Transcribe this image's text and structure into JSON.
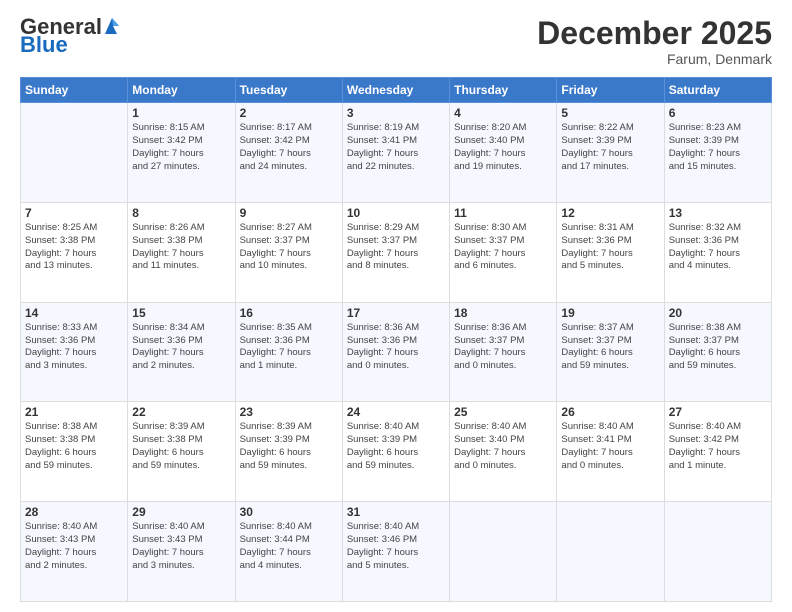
{
  "header": {
    "logo_general": "General",
    "logo_blue": "Blue",
    "month_title": "December 2025",
    "subtitle": "Farum, Denmark"
  },
  "days_of_week": [
    "Sunday",
    "Monday",
    "Tuesday",
    "Wednesday",
    "Thursday",
    "Friday",
    "Saturday"
  ],
  "weeks": [
    [
      {
        "day": "",
        "text": ""
      },
      {
        "day": "1",
        "text": "Sunrise: 8:15 AM\nSunset: 3:42 PM\nDaylight: 7 hours\nand 27 minutes."
      },
      {
        "day": "2",
        "text": "Sunrise: 8:17 AM\nSunset: 3:42 PM\nDaylight: 7 hours\nand 24 minutes."
      },
      {
        "day": "3",
        "text": "Sunrise: 8:19 AM\nSunset: 3:41 PM\nDaylight: 7 hours\nand 22 minutes."
      },
      {
        "day": "4",
        "text": "Sunrise: 8:20 AM\nSunset: 3:40 PM\nDaylight: 7 hours\nand 19 minutes."
      },
      {
        "day": "5",
        "text": "Sunrise: 8:22 AM\nSunset: 3:39 PM\nDaylight: 7 hours\nand 17 minutes."
      },
      {
        "day": "6",
        "text": "Sunrise: 8:23 AM\nSunset: 3:39 PM\nDaylight: 7 hours\nand 15 minutes."
      }
    ],
    [
      {
        "day": "7",
        "text": "Sunrise: 8:25 AM\nSunset: 3:38 PM\nDaylight: 7 hours\nand 13 minutes."
      },
      {
        "day": "8",
        "text": "Sunrise: 8:26 AM\nSunset: 3:38 PM\nDaylight: 7 hours\nand 11 minutes."
      },
      {
        "day": "9",
        "text": "Sunrise: 8:27 AM\nSunset: 3:37 PM\nDaylight: 7 hours\nand 10 minutes."
      },
      {
        "day": "10",
        "text": "Sunrise: 8:29 AM\nSunset: 3:37 PM\nDaylight: 7 hours\nand 8 minutes."
      },
      {
        "day": "11",
        "text": "Sunrise: 8:30 AM\nSunset: 3:37 PM\nDaylight: 7 hours\nand 6 minutes."
      },
      {
        "day": "12",
        "text": "Sunrise: 8:31 AM\nSunset: 3:36 PM\nDaylight: 7 hours\nand 5 minutes."
      },
      {
        "day": "13",
        "text": "Sunrise: 8:32 AM\nSunset: 3:36 PM\nDaylight: 7 hours\nand 4 minutes."
      }
    ],
    [
      {
        "day": "14",
        "text": "Sunrise: 8:33 AM\nSunset: 3:36 PM\nDaylight: 7 hours\nand 3 minutes."
      },
      {
        "day": "15",
        "text": "Sunrise: 8:34 AM\nSunset: 3:36 PM\nDaylight: 7 hours\nand 2 minutes."
      },
      {
        "day": "16",
        "text": "Sunrise: 8:35 AM\nSunset: 3:36 PM\nDaylight: 7 hours\nand 1 minute."
      },
      {
        "day": "17",
        "text": "Sunrise: 8:36 AM\nSunset: 3:36 PM\nDaylight: 7 hours\nand 0 minutes."
      },
      {
        "day": "18",
        "text": "Sunrise: 8:36 AM\nSunset: 3:37 PM\nDaylight: 7 hours\nand 0 minutes."
      },
      {
        "day": "19",
        "text": "Sunrise: 8:37 AM\nSunset: 3:37 PM\nDaylight: 6 hours\nand 59 minutes."
      },
      {
        "day": "20",
        "text": "Sunrise: 8:38 AM\nSunset: 3:37 PM\nDaylight: 6 hours\nand 59 minutes."
      }
    ],
    [
      {
        "day": "21",
        "text": "Sunrise: 8:38 AM\nSunset: 3:38 PM\nDaylight: 6 hours\nand 59 minutes."
      },
      {
        "day": "22",
        "text": "Sunrise: 8:39 AM\nSunset: 3:38 PM\nDaylight: 6 hours\nand 59 minutes."
      },
      {
        "day": "23",
        "text": "Sunrise: 8:39 AM\nSunset: 3:39 PM\nDaylight: 6 hours\nand 59 minutes."
      },
      {
        "day": "24",
        "text": "Sunrise: 8:40 AM\nSunset: 3:39 PM\nDaylight: 6 hours\nand 59 minutes."
      },
      {
        "day": "25",
        "text": "Sunrise: 8:40 AM\nSunset: 3:40 PM\nDaylight: 7 hours\nand 0 minutes."
      },
      {
        "day": "26",
        "text": "Sunrise: 8:40 AM\nSunset: 3:41 PM\nDaylight: 7 hours\nand 0 minutes."
      },
      {
        "day": "27",
        "text": "Sunrise: 8:40 AM\nSunset: 3:42 PM\nDaylight: 7 hours\nand 1 minute."
      }
    ],
    [
      {
        "day": "28",
        "text": "Sunrise: 8:40 AM\nSunset: 3:43 PM\nDaylight: 7 hours\nand 2 minutes."
      },
      {
        "day": "29",
        "text": "Sunrise: 8:40 AM\nSunset: 3:43 PM\nDaylight: 7 hours\nand 3 minutes."
      },
      {
        "day": "30",
        "text": "Sunrise: 8:40 AM\nSunset: 3:44 PM\nDaylight: 7 hours\nand 4 minutes."
      },
      {
        "day": "31",
        "text": "Sunrise: 8:40 AM\nSunset: 3:46 PM\nDaylight: 7 hours\nand 5 minutes."
      },
      {
        "day": "",
        "text": ""
      },
      {
        "day": "",
        "text": ""
      },
      {
        "day": "",
        "text": ""
      }
    ]
  ]
}
